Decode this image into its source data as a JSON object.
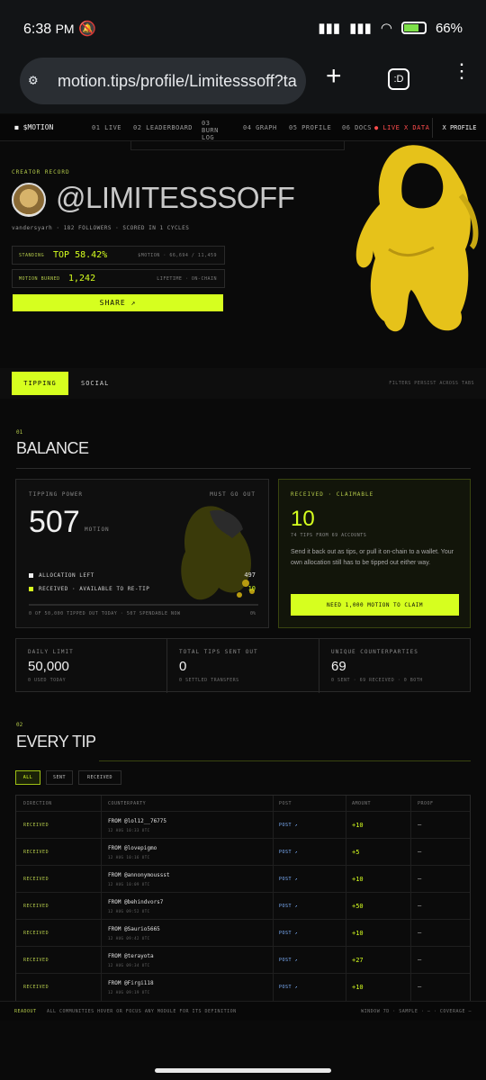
{
  "status": {
    "time": "6:38",
    "ampm": "PM",
    "battery": "66%"
  },
  "browser": {
    "url": "motion.tips/profile/Limitesssoff?ta",
    "tab_count": ":D"
  },
  "nav": {
    "brand": "$MOTION",
    "items": [
      {
        "num": "01",
        "label": "LIVE"
      },
      {
        "num": "02",
        "label": "LEADERBOARD"
      },
      {
        "num": "03",
        "label": "BURN LOG"
      },
      {
        "num": "04",
        "label": "GRAPH"
      },
      {
        "num": "05",
        "label": "PROFILE"
      },
      {
        "num": "06",
        "label": "DOCS"
      }
    ],
    "live": "● LIVE X DATA",
    "profile_btn": "X PROFILE"
  },
  "hero": {
    "creator_record": "CREATOR RECORD",
    "handle": "@LIMITESSSOFF",
    "meta": "vandersyarh · 182 FOLLOWERS · SCORED IN 1 CYCLES",
    "standing_label": "STANDING",
    "standing_value": "TOP 58.42%",
    "standing_right": "$MOTION · 66,694 / 11,459",
    "burned_label": "MOTION BURNED",
    "burned_value": "1,242",
    "burned_right": "LIFETIME · ON-CHAIN",
    "share": "SHARE ↗"
  },
  "tabs": {
    "tipping": "TIPPING",
    "social": "SOCIAL",
    "note": "FILTERS PERSIST ACROSS TABS"
  },
  "balance": {
    "num": "01",
    "title": "BALANCE",
    "tipping_power": {
      "label": "TIPPING POWER",
      "must_go_out": "MUST GO OUT",
      "value": "507",
      "unit": "MOTION",
      "allocation_label": "ALLOCATION LEFT",
      "allocation_value": "497",
      "received_label": "RECEIVED · AVAILABLE TO RE-TIP",
      "received_value": "10",
      "footer": "0 OF 50,000 TIPPED OUT TODAY · 507 SPENDABLE NOW",
      "footer_pct": "0%",
      "progress": 0
    },
    "received": {
      "label": "RECEIVED · CLAIMABLE",
      "value": "10",
      "sub": "74 TIPS FROM 69 ACCOUNTS",
      "desc": "Send it back out as tips, or pull it on-chain to a wallet. Your own allocation still has to be tipped out either way.",
      "button": "NEED 1,000 MOTION TO CLAIM"
    },
    "stats": [
      {
        "label": "DAILY LIMIT",
        "value": "50,000",
        "sub": "0 USED TODAY"
      },
      {
        "label": "TOTAL TIPS SENT OUT",
        "value": "0",
        "sub": "0 SETTLED TRANSFERS"
      },
      {
        "label": "UNIQUE COUNTERPARTIES",
        "value": "69",
        "sub": "0 SENT · 69 RECEIVED · 0 BOTH"
      }
    ]
  },
  "every_tip": {
    "num": "02",
    "title": "EVERY TIP",
    "filters": [
      "ALL",
      "SENT",
      "RECEIVED"
    ],
    "columns": [
      "DIRECTION",
      "COUNTERPARTY",
      "POST",
      "AMOUNT",
      "PROOF"
    ],
    "rows": [
      {
        "direction": "RECEIVED",
        "from": "FROM @lol12__76775",
        "time": "12 AUG 10:33 UTC",
        "post": "POST ↗",
        "amount": "+10",
        "proof": "—"
      },
      {
        "direction": "RECEIVED",
        "from": "FROM @lovepigmo",
        "time": "12 AUG 10:16 UTC",
        "post": "POST ↗",
        "amount": "+5",
        "proof": "—"
      },
      {
        "direction": "RECEIVED",
        "from": "FROM @annonymoussst",
        "time": "12 AUG 10:09 UTC",
        "post": "POST ↗",
        "amount": "+10",
        "proof": "—"
      },
      {
        "direction": "RECEIVED",
        "from": "FROM @behindvors7",
        "time": "12 AUG 09:52 UTC",
        "post": "POST ↗",
        "amount": "+50",
        "proof": "—"
      },
      {
        "direction": "RECEIVED",
        "from": "FROM @Saurio5665",
        "time": "12 AUG 09:42 UTC",
        "post": "POST ↗",
        "amount": "+10",
        "proof": "—"
      },
      {
        "direction": "RECEIVED",
        "from": "FROM @terayota",
        "time": "12 AUG 09:34 UTC",
        "post": "POST ↗",
        "amount": "+27",
        "proof": "—"
      },
      {
        "direction": "RECEIVED",
        "from": "FROM @Firgi118",
        "time": "12 AUG 09:19 UTC",
        "post": "POST ↗",
        "amount": "+10",
        "proof": "—"
      }
    ]
  },
  "readout": {
    "label": "READOUT",
    "message": "ALL COMMUNITIES   HOVER OR FOCUS ANY MODULE FOR ITS DEFINITION",
    "right": "WINDOW 7D · SAMPLE · — · COVERAGE —"
  },
  "colors": {
    "accent": "#d6ff1f",
    "background": "#0a0a0a",
    "mascot": "#e6c21a"
  }
}
